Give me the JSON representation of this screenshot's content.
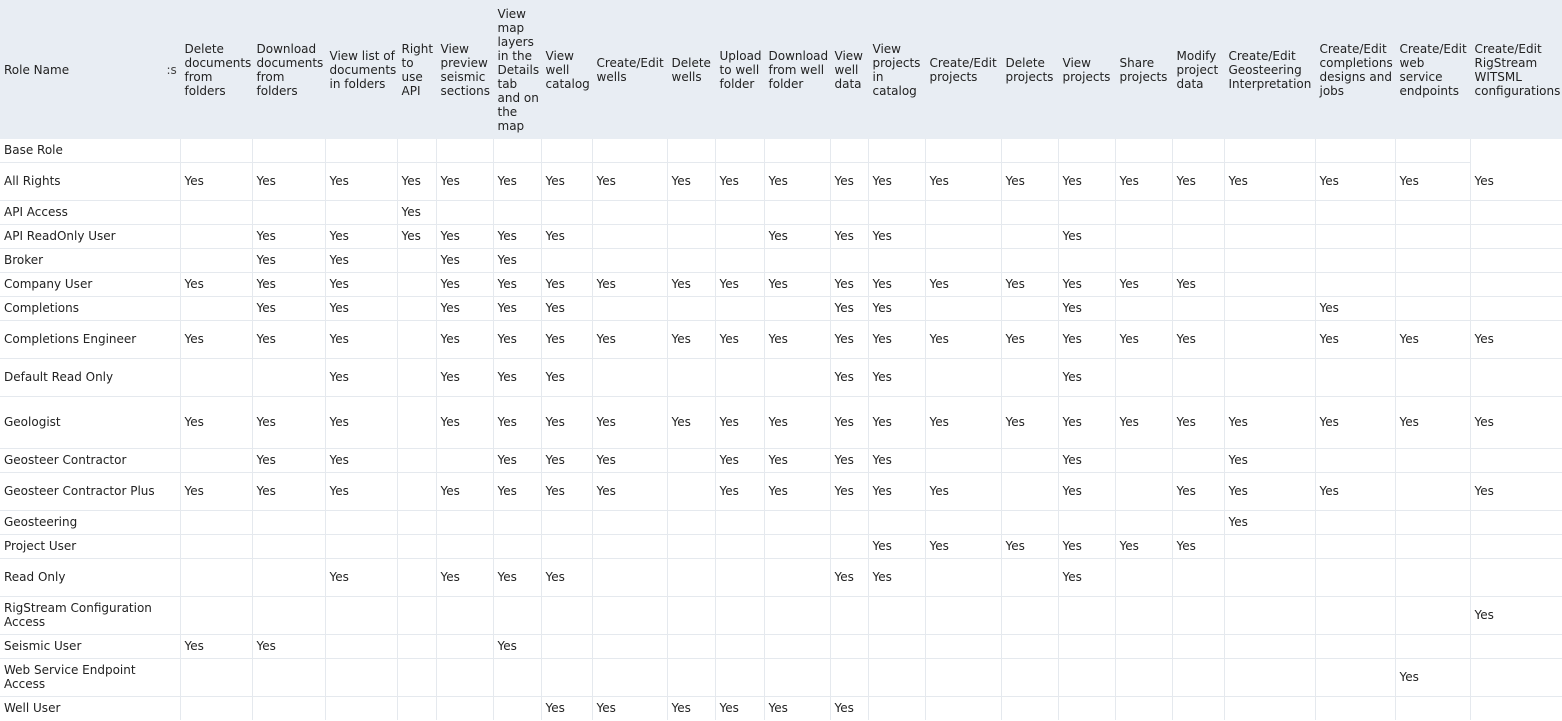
{
  "table": {
    "headers": [
      "Role Name",
      ":s",
      "Delete documents from folders",
      "Download documents from folders",
      "View list of documents in folders",
      "Right to use API",
      "View preview seismic sections",
      "View map layers in the Details tab and on the map",
      "View well catalog",
      "Create/Edit wells",
      "Delete wells",
      "Upload to well folder",
      "Download from well folder",
      "View well data",
      "View projects in catalog",
      "Create/Edit projects",
      "Delete projects",
      "View projects",
      "Share projects",
      "Modify project data",
      "Create/Edit Geosteering Interpretation",
      "Create/Edit completions designs and jobs",
      "Create/Edit web service endpoints",
      "Create/Edit RigStream WITSML configurations"
    ],
    "rows": [
      {
        "role": "Base Role",
        "cells": [
          "",
          "",
          "",
          "",
          "",
          "",
          "",
          "",
          "",
          "",
          "",
          "",
          "",
          "",
          "",
          "",
          "",
          "",
          "",
          "",
          ""
        ]
      },
      {
        "role": "All Rights",
        "cells": [
          "Yes",
          "Yes",
          "Yes",
          "Yes",
          "Yes",
          "Yes",
          "Yes",
          "Yes",
          "Yes",
          "Yes",
          "Yes",
          "Yes",
          "Yes",
          "Yes",
          "Yes",
          "Yes",
          "Yes",
          "Yes",
          "Yes",
          "Yes",
          "Yes",
          "Yes"
        ]
      },
      {
        "role": "API Access",
        "cells": [
          "",
          "",
          "",
          "Yes",
          "",
          "",
          "",
          "",
          "",
          "",
          "",
          "",
          "",
          "",
          "",
          "",
          "",
          "",
          "",
          "",
          "",
          ""
        ]
      },
      {
        "role": "API ReadOnly User",
        "cells": [
          "",
          "Yes",
          "Yes",
          "Yes",
          "Yes",
          "Yes",
          "Yes",
          "",
          "",
          "",
          "Yes",
          "Yes",
          "Yes",
          "",
          "",
          "Yes",
          "",
          "",
          "",
          "",
          "",
          ""
        ]
      },
      {
        "role": "Broker",
        "cells": [
          "",
          "Yes",
          "Yes",
          "",
          "Yes",
          "Yes",
          "",
          "",
          "",
          "",
          "",
          "",
          "",
          "",
          "",
          "",
          "",
          "",
          "",
          "",
          "",
          ""
        ]
      },
      {
        "role": "Company User",
        "cells": [
          "Yes",
          "Yes",
          "Yes",
          "",
          "Yes",
          "Yes",
          "Yes",
          "Yes",
          "Yes",
          "Yes",
          "Yes",
          "Yes",
          "Yes",
          "Yes",
          "Yes",
          "Yes",
          "Yes",
          "Yes",
          "",
          "",
          "",
          ""
        ]
      },
      {
        "role": "Completions",
        "cells": [
          "",
          "Yes",
          "Yes",
          "",
          "Yes",
          "Yes",
          "Yes",
          "",
          "",
          "",
          "",
          "Yes",
          "Yes",
          "",
          "",
          "Yes",
          "",
          "",
          "",
          "Yes",
          "",
          ""
        ]
      },
      {
        "role": "Completions Engineer",
        "cells": [
          "Yes",
          "Yes",
          "Yes",
          "",
          "Yes",
          "Yes",
          "Yes",
          "Yes",
          "Yes",
          "Yes",
          "Yes",
          "Yes",
          "Yes",
          "Yes",
          "Yes",
          "Yes",
          "Yes",
          "Yes",
          "",
          "Yes",
          "Yes",
          "Yes"
        ]
      },
      {
        "role": "Default Read Only",
        "cells": [
          "",
          "",
          "Yes",
          "",
          "Yes",
          "Yes",
          "Yes",
          "",
          "",
          "",
          "",
          "Yes",
          "Yes",
          "",
          "",
          "Yes",
          "",
          "",
          "",
          "",
          "",
          ""
        ]
      },
      {
        "role": "Geologist",
        "cells": [
          "Yes",
          "Yes",
          "Yes",
          "",
          "Yes",
          "Yes",
          "Yes",
          "Yes",
          "Yes",
          "Yes",
          "Yes",
          "Yes",
          "Yes",
          "Yes",
          "Yes",
          "Yes",
          "Yes",
          "Yes",
          "Yes",
          "Yes",
          "Yes",
          "Yes"
        ]
      },
      {
        "role": "Geosteer Contractor",
        "cells": [
          "",
          "Yes",
          "Yes",
          "",
          "",
          "Yes",
          "Yes",
          "Yes",
          "",
          "Yes",
          "Yes",
          "Yes",
          "Yes",
          "",
          "",
          "Yes",
          "",
          "",
          "Yes",
          "",
          "",
          ""
        ]
      },
      {
        "role": "Geosteer Contractor Plus",
        "cells": [
          "Yes",
          "Yes",
          "Yes",
          "",
          "Yes",
          "Yes",
          "Yes",
          "Yes",
          "",
          "Yes",
          "Yes",
          "Yes",
          "Yes",
          "Yes",
          "",
          "Yes",
          "",
          "Yes",
          "Yes",
          "Yes",
          "",
          "Yes"
        ]
      },
      {
        "role": "Geosteering",
        "cells": [
          "",
          "",
          "",
          "",
          "",
          "",
          "",
          "",
          "",
          "",
          "",
          "",
          "",
          "",
          "",
          "",
          "",
          "",
          "Yes",
          "",
          "",
          ""
        ]
      },
      {
        "role": "Project User",
        "cells": [
          "",
          "",
          "",
          "",
          "",
          "",
          "",
          "",
          "",
          "",
          "",
          "",
          "Yes",
          "Yes",
          "Yes",
          "Yes",
          "Yes",
          "Yes",
          "",
          "",
          "",
          ""
        ]
      },
      {
        "role": "Read Only",
        "cells": [
          "",
          "",
          "Yes",
          "",
          "Yes",
          "Yes",
          "Yes",
          "",
          "",
          "",
          "",
          "Yes",
          "Yes",
          "",
          "",
          "Yes",
          "",
          "",
          "",
          "",
          "",
          ""
        ]
      },
      {
        "role": "RigStream Configuration Access",
        "cells": [
          "",
          "",
          "",
          "",
          "",
          "",
          "",
          "",
          "",
          "",
          "",
          "",
          "",
          "",
          "",
          "",
          "",
          "",
          "",
          "",
          "",
          "Yes"
        ]
      },
      {
        "role": "Seismic User",
        "cells": [
          "Yes",
          "Yes",
          "",
          "",
          "",
          "Yes",
          "",
          "",
          "",
          "",
          "",
          "",
          "",
          "",
          "",
          "",
          "",
          "",
          "",
          "",
          "",
          ""
        ]
      },
      {
        "role": "Web Service Endpoint Access",
        "cells": [
          "",
          "",
          "",
          "",
          "",
          "",
          "",
          "",
          "",
          "",
          "",
          "",
          "",
          "",
          "",
          "",
          "",
          "",
          "",
          "",
          "Yes",
          ""
        ]
      },
      {
        "role": "Well User",
        "cells": [
          "",
          "",
          "",
          "",
          "",
          "",
          "Yes",
          "Yes",
          "Yes",
          "Yes",
          "Yes",
          "Yes",
          "",
          "",
          "",
          "",
          "",
          "",
          "",
          "",
          "",
          ""
        ]
      }
    ]
  },
  "colors": {
    "header_bg": "#e8edf3",
    "grid_line": "#e5e9ee",
    "text": "#222222"
  }
}
